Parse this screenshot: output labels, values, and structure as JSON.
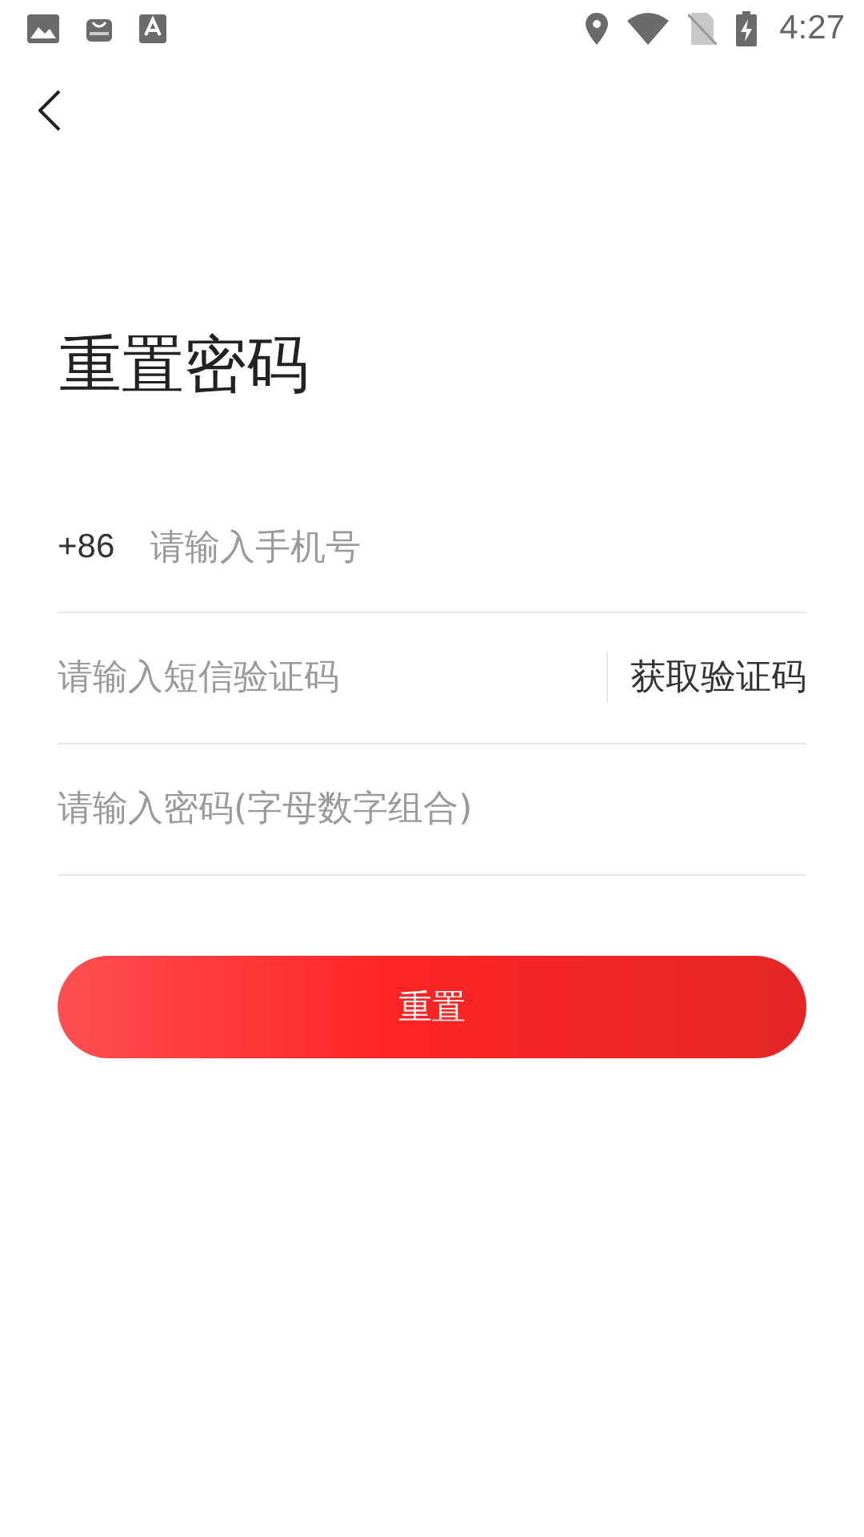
{
  "status_bar": {
    "time": "4:27"
  },
  "title": "重置密码",
  "fields": [
    {
      "kind": "phone",
      "prefix": "+86",
      "placeholder": "请输入手机号"
    },
    {
      "kind": "code",
      "placeholder": "请输入短信验证码",
      "action": "获取验证码"
    },
    {
      "kind": "password",
      "placeholder": "请输入密码(字母数字组合)"
    }
  ],
  "submit_button": "重置"
}
